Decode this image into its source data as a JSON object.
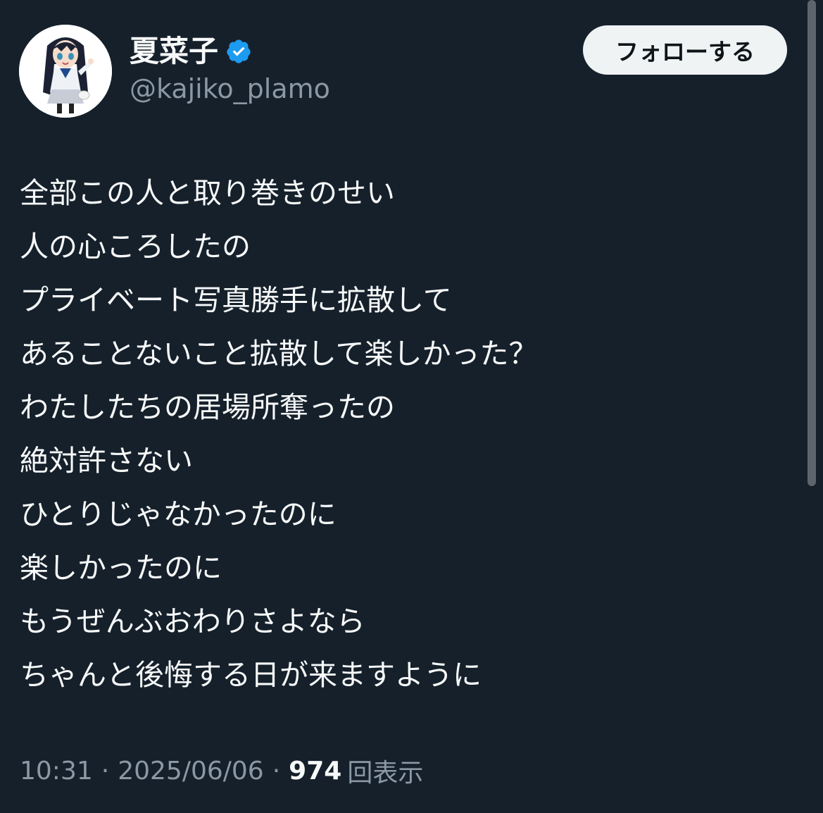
{
  "profile": {
    "display_name": "夏菜子",
    "handle": "@kajiko_plamo",
    "verified": true,
    "avatar_icon": "anime-character-avatar"
  },
  "follow_button": {
    "label": "フォローする"
  },
  "tweet": {
    "lines": [
      "全部この人と取り巻きのせい",
      "人の心ころしたの",
      "プライベート写真勝手に拡散して",
      "あることないこと拡散して楽しかった？",
      "わたしたちの居場所奪ったの",
      "絶対許さない",
      "ひとりじゃなかったのに",
      "楽しかったのに",
      "もうぜんぶおわりさよなら",
      "ちゃんと後悔する日が来ますように"
    ]
  },
  "meta": {
    "time": "10:31",
    "separator": "·",
    "date": "2025/06/06",
    "views_count": "974",
    "views_label": "回表示"
  },
  "colors": {
    "background": "#15202b",
    "text_primary": "#f7f9f9",
    "text_secondary": "#8b98a5",
    "verified_badge": "#1d9bf0",
    "follow_button_bg": "#eff3f4",
    "follow_button_text": "#0f1419"
  }
}
